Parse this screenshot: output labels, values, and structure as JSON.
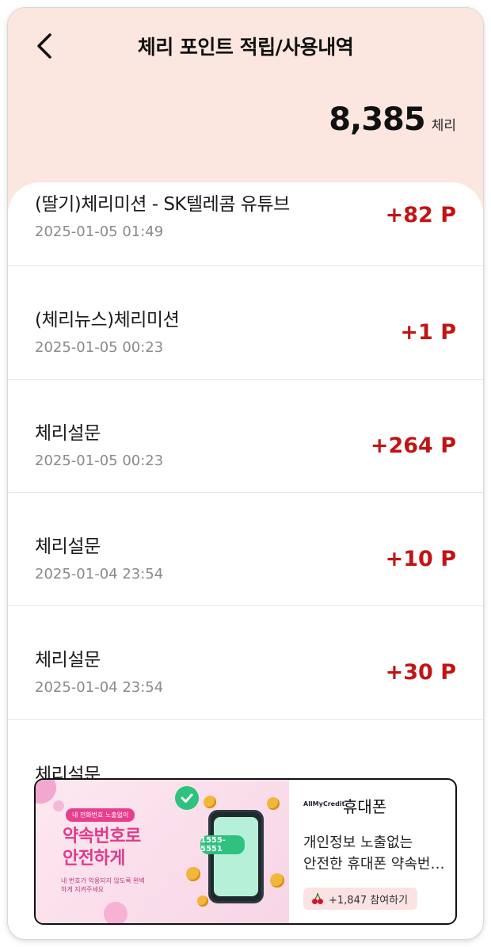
{
  "header": {
    "title": "체리 포인트 적립/사용내역",
    "balance_value": "8,385",
    "balance_unit": "체리"
  },
  "history": [
    {
      "title": "(딸기)체리미션 - SK텔레콤 유튜브",
      "date": "2025-01-05 01:49",
      "points": "+82 P"
    },
    {
      "title": "(체리뉴스)체리미션",
      "date": "2025-01-05 00:23",
      "points": "+1 P"
    },
    {
      "title": "체리설문",
      "date": "2025-01-05 00:23",
      "points": "+264 P"
    },
    {
      "title": "체리설문",
      "date": "2025-01-04 23:54",
      "points": "+10 P"
    },
    {
      "title": "체리설문",
      "date": "2025-01-04 23:54",
      "points": "+30 P"
    },
    {
      "title": "체리설문",
      "date": "",
      "points": ""
    }
  ],
  "ad": {
    "banner_chip": "내 전화번호 노출없이",
    "banner_headline_line1": "약속번호로",
    "banner_headline_line2": "안전하게",
    "banner_sub": "내 번호가 악용되지 않도록 완벽하게 지켜주세요",
    "bubble_number": "1555-5551",
    "brand": "AllMyCredit",
    "category": "휴대폰",
    "desc_line1": "개인정보 노출없는",
    "desc_line2": "안전한 휴대폰 약속번…",
    "cta": "+1,847 참여하기"
  },
  "colors": {
    "header_bg": "#fce6e0",
    "points": "#c01515",
    "accent_pink": "#e73f8d"
  }
}
